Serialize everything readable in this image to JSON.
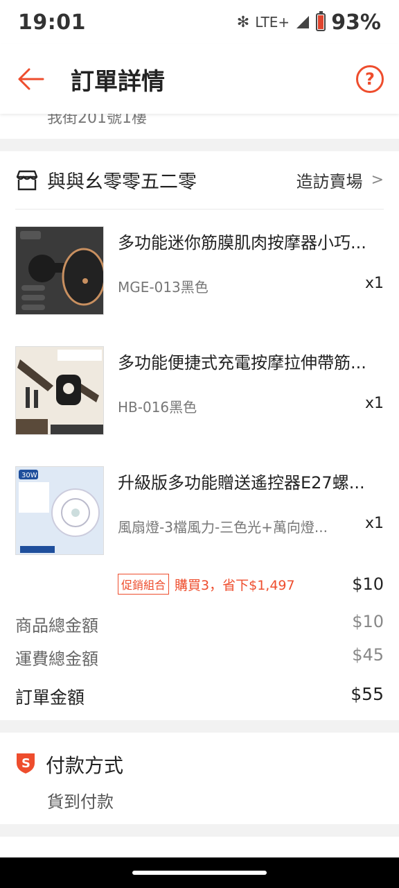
{
  "status": {
    "time": "19:01",
    "network": "LTE+",
    "battery": "93%"
  },
  "app_bar": {
    "title": "訂單詳情",
    "help_glyph": "?"
  },
  "address": {
    "partial_text": "我街201號1樓"
  },
  "shop": {
    "name": "與與幺零零五二零",
    "visit_label": "造訪賣場",
    "items": [
      {
        "title": "多功能迷你筋膜肌肉按摩器小巧...",
        "variant": "MGE-013黑色",
        "qty": "x1",
        "thumb": "massager-gun-image"
      },
      {
        "title": "多功能便捷式充電按摩拉伸帶筋...",
        "variant": "HB-016黑色",
        "qty": "x1",
        "thumb": "stretch-band-massager-image"
      },
      {
        "title": "升級版多功能贈送遙控器E27螺...",
        "variant": "風扇燈-3檔風力-三色光+萬向燈...",
        "qty": "x1",
        "thumb": "fan-light-image"
      }
    ],
    "promo": {
      "tag": "促銷組合",
      "text": "購買3，省下$1,497",
      "price": "$10"
    },
    "summary": {
      "subtotal_label": "商品總金額",
      "subtotal": "$10",
      "shipping_label": "運費總金額",
      "shipping": "$45",
      "total_label": "訂單金額",
      "total": "$55"
    }
  },
  "payment": {
    "title": "付款方式",
    "method": "貨到付款"
  },
  "colors": {
    "accent": "#ee4d2d",
    "background": "#f2f2f2"
  }
}
